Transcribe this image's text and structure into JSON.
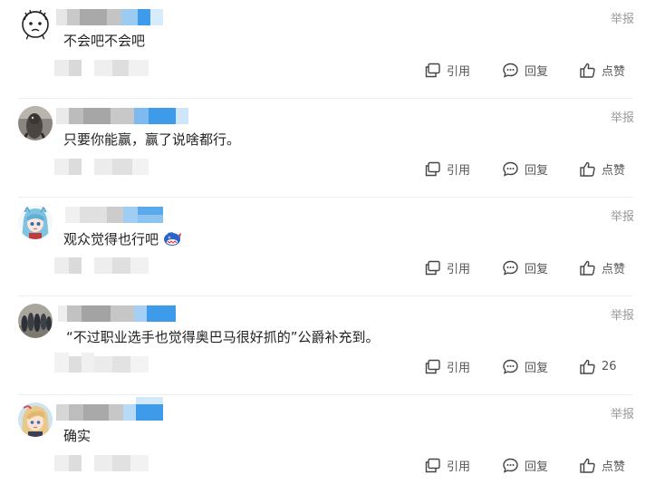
{
  "comments": [
    {
      "content": "不会吧不会吧",
      "report_label": "举报",
      "quote_label": "引用",
      "reply_label": "回复",
      "like_label": "点赞",
      "avatar": "doodle-face-avatar"
    },
    {
      "content": "只要你能赢，赢了说啥都行。",
      "report_label": "举报",
      "quote_label": "引用",
      "reply_label": "回复",
      "like_label": "点赞",
      "avatar": "creature-photo-avatar"
    },
    {
      "content": "观众觉得也行吧",
      "report_label": "举报",
      "quote_label": "引用",
      "reply_label": "回复",
      "like_label": "点赞",
      "avatar": "anime-girl-avatar",
      "emoji": "shark-emoji"
    },
    {
      "content": "“不过职业选手也觉得奥巴马很好抓的”公爵补充到。",
      "report_label": "举报",
      "quote_label": "引用",
      "reply_label": "回复",
      "like_label": "26",
      "avatar": "bowling-pins-avatar"
    },
    {
      "content": "确实",
      "report_label": "举报",
      "quote_label": "引用",
      "reply_label": "回复",
      "like_label": "点赞",
      "avatar": "anime-blonde-avatar"
    }
  ],
  "colors": {
    "text": "#222222",
    "muted": "#999999",
    "action": "#555555",
    "blur_blue": "#3d9be9",
    "blur_gray": "#b0b0b0"
  }
}
